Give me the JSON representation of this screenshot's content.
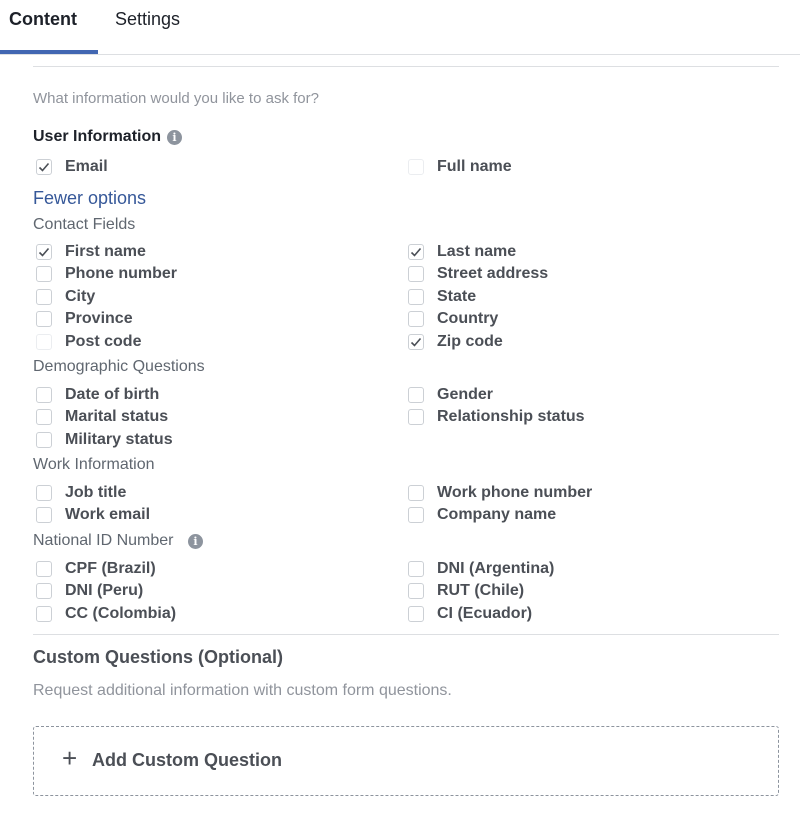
{
  "tabs": [
    {
      "label": "Content",
      "active": true
    },
    {
      "label": "Settings",
      "active": false
    }
  ],
  "prompt": "What information would you like to ask for?",
  "user_information": {
    "title": "User Information",
    "info_icon": "info-icon",
    "fields": [
      {
        "label": "Email",
        "checked": true,
        "disabled": false
      },
      {
        "label": "Full name",
        "checked": false,
        "disabled": true
      }
    ]
  },
  "fewer_options": "Fewer options",
  "groups": [
    {
      "label": "Contact Fields",
      "fields": [
        {
          "label": "First name",
          "checked": true
        },
        {
          "label": "Last name",
          "checked": true
        },
        {
          "label": "Phone number",
          "checked": false
        },
        {
          "label": "Street address",
          "checked": false
        },
        {
          "label": "City",
          "checked": false
        },
        {
          "label": "State",
          "checked": false
        },
        {
          "label": "Province",
          "checked": false
        },
        {
          "label": "Country",
          "checked": false
        },
        {
          "label": "Post code",
          "checked": false,
          "disabled": true
        },
        {
          "label": "Zip code",
          "checked": true
        }
      ]
    },
    {
      "label": "Demographic Questions",
      "fields": [
        {
          "label": "Date of birth",
          "checked": false
        },
        {
          "label": "Gender",
          "checked": false
        },
        {
          "label": "Marital status",
          "checked": false
        },
        {
          "label": "Relationship status",
          "checked": false
        },
        {
          "label": "Military status",
          "checked": false
        }
      ]
    },
    {
      "label": "Work Information",
      "fields": [
        {
          "label": "Job title",
          "checked": false
        },
        {
          "label": "Work phone number",
          "checked": false
        },
        {
          "label": "Work email",
          "checked": false
        },
        {
          "label": "Company name",
          "checked": false
        }
      ]
    },
    {
      "label": "National ID Number",
      "has_info_icon": true,
      "fields": [
        {
          "label": "CPF (Brazil)",
          "checked": false
        },
        {
          "label": "DNI (Argentina)",
          "checked": false
        },
        {
          "label": "DNI (Peru)",
          "checked": false
        },
        {
          "label": "RUT (Chile)",
          "checked": false
        },
        {
          "label": "CC (Colombia)",
          "checked": false
        },
        {
          "label": "CI (Ecuador)",
          "checked": false
        }
      ]
    }
  ],
  "custom_questions": {
    "title": "Custom Questions (Optional)",
    "description": "Request additional information with custom form questions.",
    "add_button": {
      "icon": "plus-icon",
      "label": "Add Custom Question"
    }
  },
  "colors": {
    "accent": "#4267b2",
    "link": "#365899",
    "checkmark": "#4b4f56"
  }
}
